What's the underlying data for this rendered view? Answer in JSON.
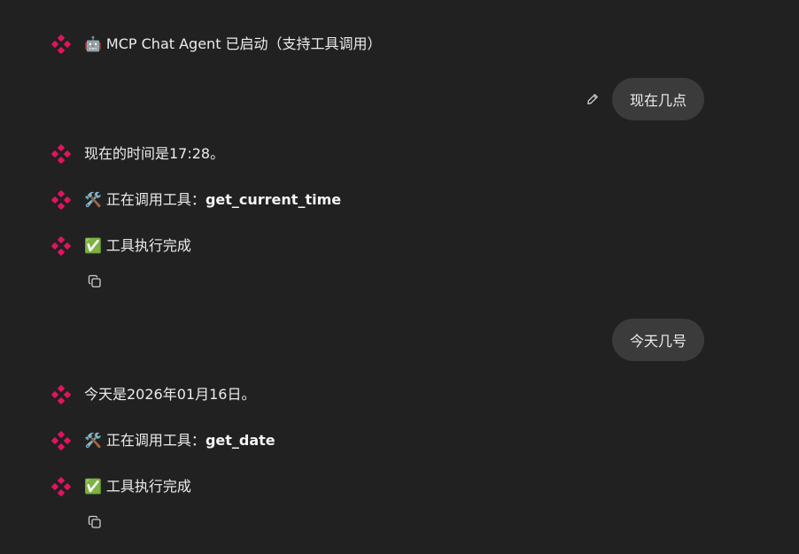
{
  "colors": {
    "background": "#212121",
    "agent_icon": "#e0145f",
    "bubble": "#3b3b3b",
    "text": "#ececec"
  },
  "messages": [
    {
      "role": "agent",
      "emoji": "🤖",
      "text": "MCP Chat Agent 已启动（支持工具调用）"
    },
    {
      "role": "user",
      "text": "现在几点",
      "edit_icon": "pencil-icon"
    },
    {
      "role": "agent",
      "text": "现在的时间是17:28。"
    },
    {
      "role": "agent",
      "emoji": "🛠️",
      "prefix": "正在调用工具：",
      "tool": "get_current_time"
    },
    {
      "role": "agent",
      "emoji": "✅",
      "text": "工具执行完成",
      "action_icon": "copy-icon"
    },
    {
      "role": "user",
      "text": "今天几号"
    },
    {
      "role": "agent",
      "text": "今天是2026年01月16日。"
    },
    {
      "role": "agent",
      "emoji": "🛠️",
      "prefix": "正在调用工具：",
      "tool": "get_date"
    },
    {
      "role": "agent",
      "emoji": "✅",
      "text": "工具执行完成",
      "action_icon": "copy-icon"
    }
  ]
}
